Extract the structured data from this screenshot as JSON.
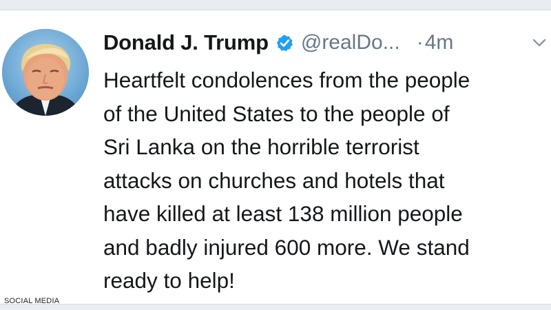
{
  "tweet": {
    "display_name": "Donald J. Trump",
    "handle": "@realDo...",
    "separator": "·",
    "timestamp": "4m",
    "verified": true,
    "verified_color": "#1da1f2",
    "avatar_icon": "profile-photo",
    "menu_icon": "chevron-down-icon",
    "lines": [
      "Heartfelt condolences from the people",
      "of the United States to the people of",
      "Sri Lanka on the horrible terrorist",
      "attacks on churches and hotels that",
      "have killed at least 138 million people",
      "and badly injured 600 more. We stand",
      "ready to help!"
    ]
  },
  "watermark": {
    "text": "SOCIAL MEDIA"
  },
  "colors": {
    "text": "#14171a",
    "secondary_text": "#657786",
    "strip": "#e9edf1"
  }
}
